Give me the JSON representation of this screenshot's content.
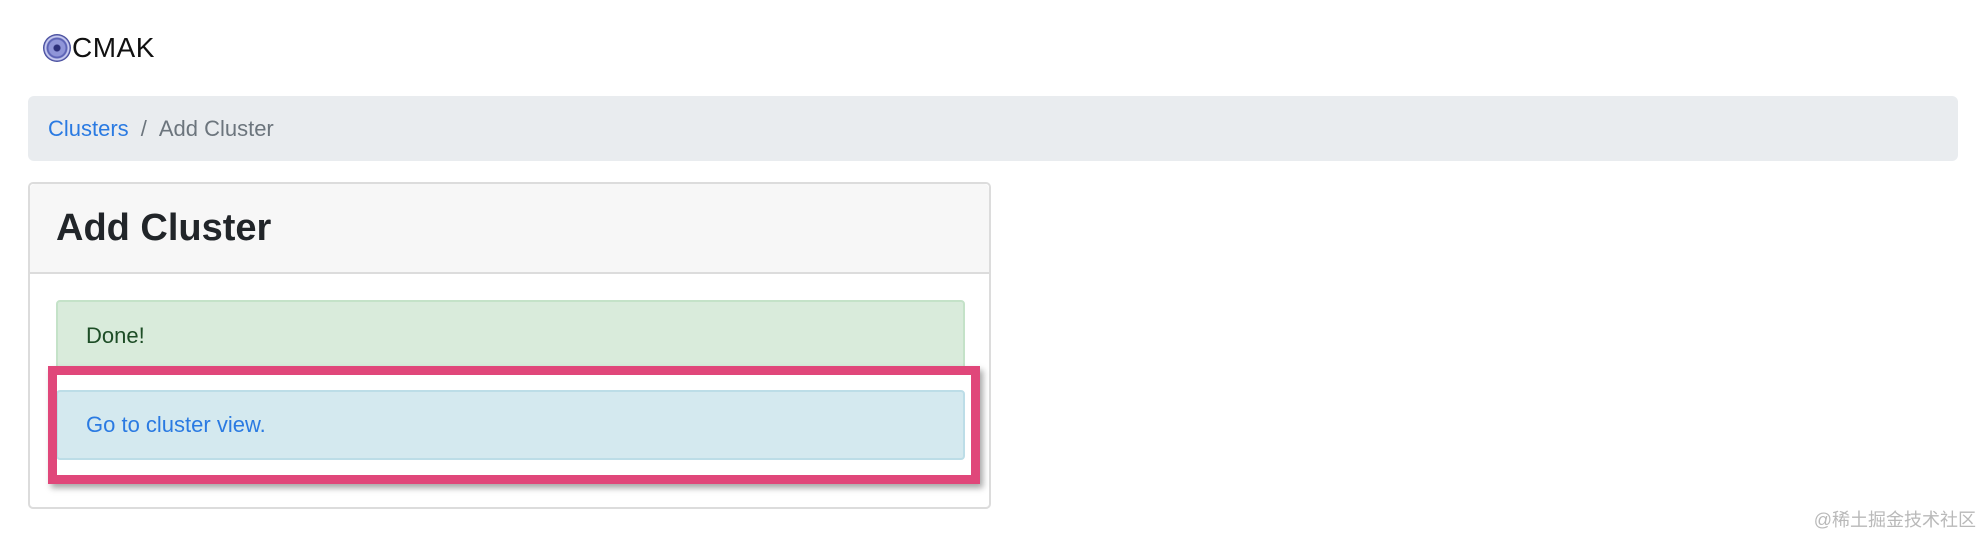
{
  "app": {
    "brand": "CMAK",
    "logo_icon": "cmak-logo-icon"
  },
  "breadcrumb": {
    "items": [
      {
        "label": "Clusters",
        "link": true
      },
      {
        "label": "Add Cluster",
        "link": false
      }
    ],
    "separator": "/"
  },
  "card": {
    "title": "Add Cluster",
    "success_message": "Done!",
    "info_link": "Go to cluster view."
  },
  "annotation": {
    "highlight_color": "#e0477a"
  },
  "watermark": "@稀土掘金技术社区",
  "colors": {
    "link": "#2a7ae2",
    "breadcrumb_bg": "#e9ecef",
    "success_bg": "#d9ebdb",
    "info_bg": "#d4e9ef"
  }
}
